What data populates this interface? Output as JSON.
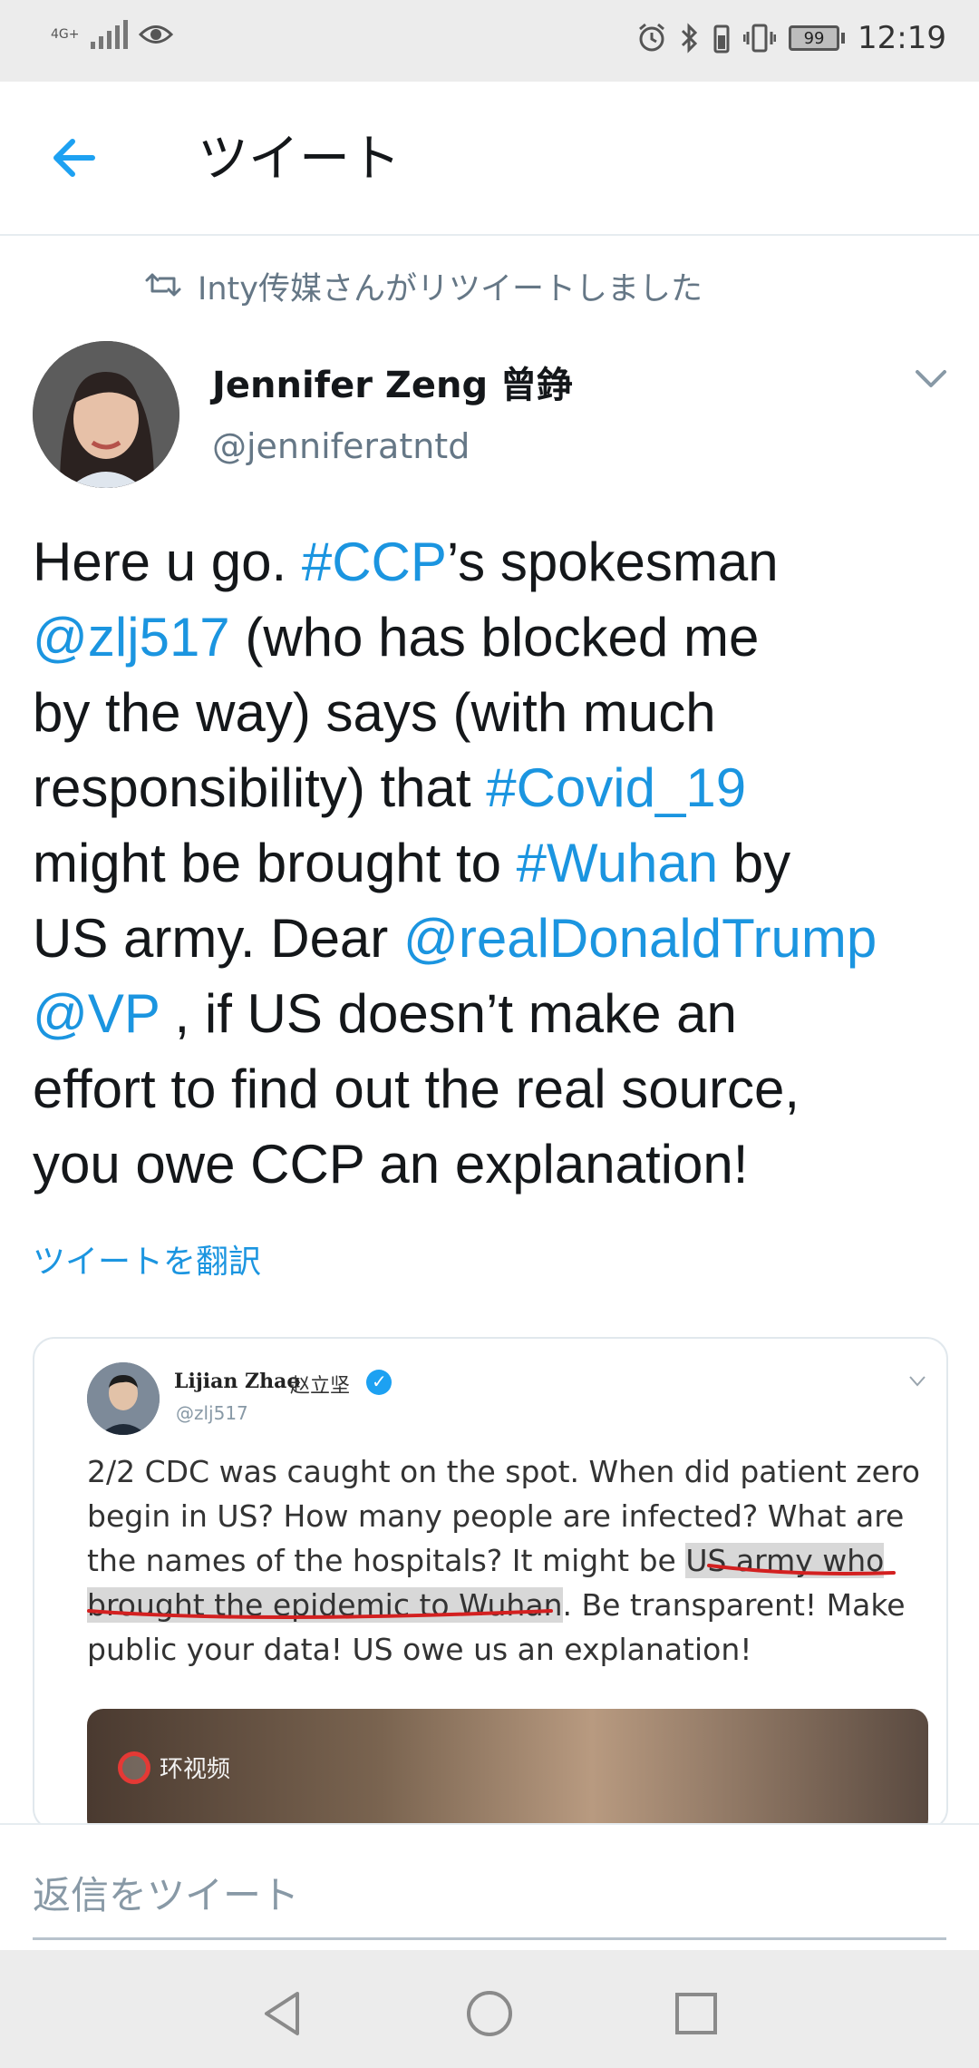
{
  "status_bar": {
    "network": "4G+",
    "battery": "99",
    "time": "12:19"
  },
  "header": {
    "title": "ツイート"
  },
  "retweet": {
    "text": "Inty传媒さんがリツイートしました"
  },
  "tweet": {
    "author_name": "Jennifer Zeng 曾錚",
    "author_handle": "@jenniferatntd",
    "lines": [
      [
        {
          "t": "Here u go. "
        },
        {
          "t": "#CCP",
          "link": true
        },
        {
          "t": "’s spokesman"
        }
      ],
      [
        {
          "t": "@zlj517",
          "link": true
        },
        {
          "t": " (who has blocked me"
        }
      ],
      [
        {
          "t": "by the way) says (with much"
        }
      ],
      [
        {
          "t": "responsibility) that "
        },
        {
          "t": "#Covid_19",
          "link": true
        }
      ],
      [
        {
          "t": "might be brought to "
        },
        {
          "t": "#Wuhan",
          "link": true
        },
        {
          "t": " by"
        }
      ],
      [
        {
          "t": "US army. Dear "
        },
        {
          "t": "@realDonaldTrump",
          "link": true
        }
      ],
      [
        {
          "t": "@VP",
          "link": true
        },
        {
          "t": " ,  if US doesn’t make an"
        }
      ],
      [
        {
          "t": "effort to find out the real source,"
        }
      ],
      [
        {
          "t": "you owe CCP an explanation!"
        }
      ]
    ],
    "translate_label": "ツイートを翻訳"
  },
  "quoted": {
    "name": "Lijian Zhao",
    "name_cn": "赵立坚",
    "handle": "@zlj517",
    "lines": [
      [
        {
          "t": "2/2 CDC was caught on the spot. When did patient zero"
        }
      ],
      [
        {
          "t": "begin in US? How many people are infected? What are"
        }
      ],
      [
        {
          "t": "the names of the hospitals? It might be "
        },
        {
          "t": "US army who",
          "hl": true
        }
      ],
      [
        {
          "t": "brought the epidemic to Wuhan",
          "hl": true
        },
        {
          "t": ". Be transparent! Make"
        }
      ],
      [
        {
          "t": "public your data! US owe us an explanation!"
        }
      ]
    ],
    "media_logo": "环视频"
  },
  "reply": {
    "placeholder": "返信をツイート"
  },
  "icons": {
    "back": "arrow-left-icon",
    "retweet": "retweet-icon",
    "more": "chevron-down-icon",
    "nav_back": "triangle-back-icon",
    "nav_home": "circle-home-icon",
    "nav_recents": "square-recents-icon"
  },
  "colors": {
    "link": "#1b95e0",
    "text": "#14171a",
    "secondary": "#657786",
    "bars": "#ececec"
  }
}
